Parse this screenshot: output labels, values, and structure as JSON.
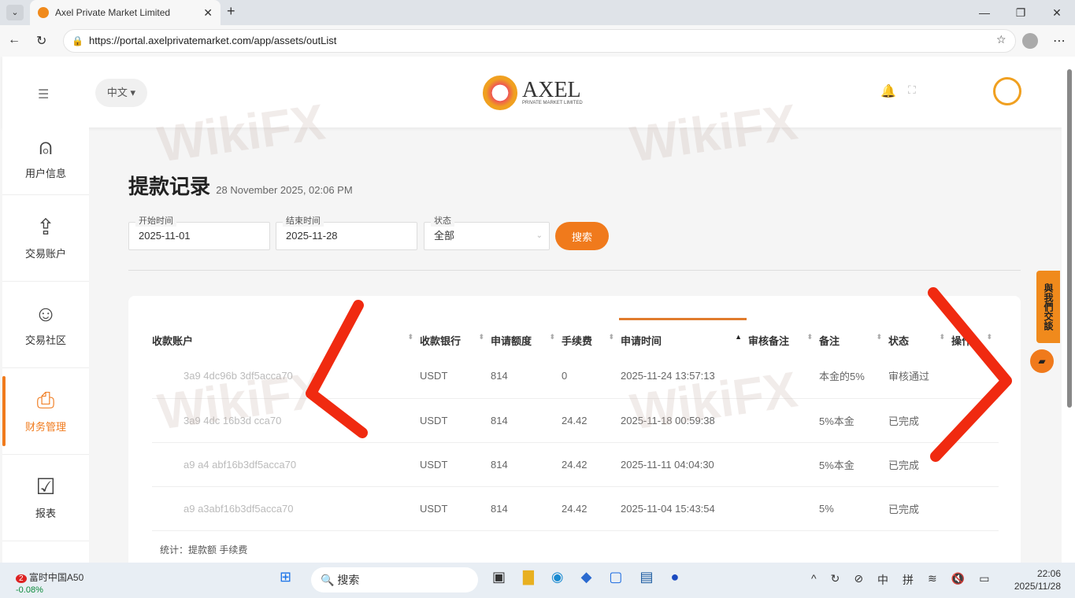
{
  "browser": {
    "tab_title": "Axel Private Market Limited",
    "url": "https://portal.axelprivatemarket.com/app/assets/outList"
  },
  "header": {
    "lang": "中文",
    "logo_text": "AXEL",
    "logo_sub": "PRIVATE MARKET LIMITED"
  },
  "sidebar": {
    "items": [
      {
        "label": "用户信息",
        "icon": "user-icon"
      },
      {
        "label": "交易账户",
        "icon": "upload-icon"
      },
      {
        "label": "交易社区",
        "icon": "community-icon"
      },
      {
        "label": "财务管理",
        "icon": "finance-icon"
      },
      {
        "label": "报表",
        "icon": "report-icon"
      }
    ]
  },
  "page": {
    "title": "提款记录",
    "timestamp": "28 November 2025, 02:06 PM"
  },
  "filters": {
    "start_label": "开始时间",
    "start": "2025-11-01",
    "end_label": "结束时间",
    "end": "2025-11-28",
    "status_label": "状态",
    "status": "全部",
    "search": "搜索"
  },
  "table": {
    "headers": [
      "收款账户",
      "收款银行",
      "申请额度",
      "手续费",
      "申请时间",
      "审核备注",
      "备注",
      "状态",
      "操作"
    ],
    "rows": [
      {
        "account": "3a9 4dc96b 3df5acca70",
        "bank": "USDT",
        "amount": "814",
        "fee": "0",
        "time": "2025-11-24 13:57:13",
        "review": "",
        "note": "本金的5%",
        "status": "审核通过"
      },
      {
        "account": "3a9 4dc 16b3d cca70",
        "bank": "USDT",
        "amount": "814",
        "fee": "24.42",
        "time": "2025-11-18 00:59:38",
        "review": "",
        "note": "5%本金",
        "status": "已完成"
      },
      {
        "account": "a9 a4 abf16b3df5acca70",
        "bank": "USDT",
        "amount": "814",
        "fee": "24.42",
        "time": "2025-11-11 04:04:30",
        "review": "",
        "note": "5%本金",
        "status": "已完成"
      },
      {
        "account": "a9 a3abf16b3df5acca70",
        "bank": "USDT",
        "amount": "814",
        "fee": "24.42",
        "time": "2025-11-04 15:43:54",
        "review": "",
        "note": "5%",
        "status": "已完成"
      }
    ],
    "summary": "统计：提款额 手续费"
  },
  "float": {
    "contact": "與我們交談"
  },
  "watermark": "WikiFX",
  "taskbar": {
    "stock_name": "富时中国A50",
    "stock_change": "-0.08%",
    "badge": "2",
    "search": "搜索",
    "ime1": "中",
    "ime2": "拼",
    "time": "22:06",
    "date": "2025/11/28"
  },
  "colors": {
    "accent": "#f07a1c"
  }
}
